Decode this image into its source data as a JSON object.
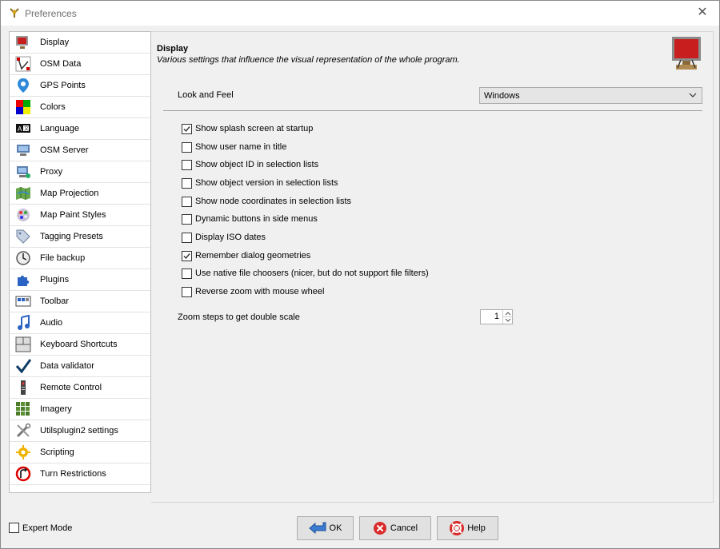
{
  "window": {
    "title": "Preferences"
  },
  "sidebar": {
    "items": [
      {
        "label": "Display",
        "icon": "display-icon",
        "selected": true
      },
      {
        "label": "OSM Data",
        "icon": "osm-data-icon"
      },
      {
        "label": "GPS Points",
        "icon": "gps-points-icon"
      },
      {
        "label": "Colors",
        "icon": "colors-icon"
      },
      {
        "label": "Language",
        "icon": "language-icon"
      },
      {
        "label": "OSM Server",
        "icon": "osm-server-icon"
      },
      {
        "label": "Proxy",
        "icon": "proxy-icon"
      },
      {
        "label": "Map Projection",
        "icon": "map-projection-icon"
      },
      {
        "label": "Map Paint Styles",
        "icon": "map-paint-styles-icon"
      },
      {
        "label": "Tagging Presets",
        "icon": "tagging-presets-icon"
      },
      {
        "label": "File backup",
        "icon": "file-backup-icon"
      },
      {
        "label": "Plugins",
        "icon": "plugins-icon"
      },
      {
        "label": "Toolbar",
        "icon": "toolbar-icon"
      },
      {
        "label": "Audio",
        "icon": "audio-icon"
      },
      {
        "label": "Keyboard Shortcuts",
        "icon": "keyboard-shortcuts-icon"
      },
      {
        "label": "Data validator",
        "icon": "data-validator-icon"
      },
      {
        "label": "Remote Control",
        "icon": "remote-control-icon"
      },
      {
        "label": "Imagery",
        "icon": "imagery-icon"
      },
      {
        "label": "Utilsplugin2 settings",
        "icon": "utilsplugin2-icon"
      },
      {
        "label": "Scripting",
        "icon": "scripting-icon"
      },
      {
        "label": "Turn Restrictions",
        "icon": "turn-restrictions-icon"
      }
    ]
  },
  "main": {
    "title": "Display",
    "description": "Various settings that influence the visual representation of the whole program.",
    "look_and_feel": {
      "label": "Look and Feel",
      "value": "Windows"
    },
    "checkboxes": [
      {
        "label": "Show splash screen at startup",
        "checked": true
      },
      {
        "label": "Show user name in title",
        "checked": false
      },
      {
        "label": "Show object ID in selection lists",
        "checked": false
      },
      {
        "label": "Show object version in selection lists",
        "checked": false
      },
      {
        "label": "Show node coordinates in selection lists",
        "checked": false
      },
      {
        "label": "Dynamic buttons in side menus",
        "checked": false
      },
      {
        "label": "Display ISO dates",
        "checked": false
      },
      {
        "label": "Remember dialog geometries",
        "checked": true
      },
      {
        "label": "Use native file choosers (nicer, but do not support file filters)",
        "checked": false
      },
      {
        "label": "Reverse zoom with mouse wheel",
        "checked": false
      }
    ],
    "zoom_steps": {
      "label": "Zoom steps to get double scale",
      "value": "1"
    }
  },
  "footer": {
    "expert_mode": {
      "label": "Expert Mode",
      "checked": false
    },
    "ok_label": "OK",
    "cancel_label": "Cancel",
    "help_label": "Help"
  },
  "colors": {
    "accent": "#1a5fb4",
    "check": "#333333",
    "selection_border": "#cfcfcf"
  }
}
